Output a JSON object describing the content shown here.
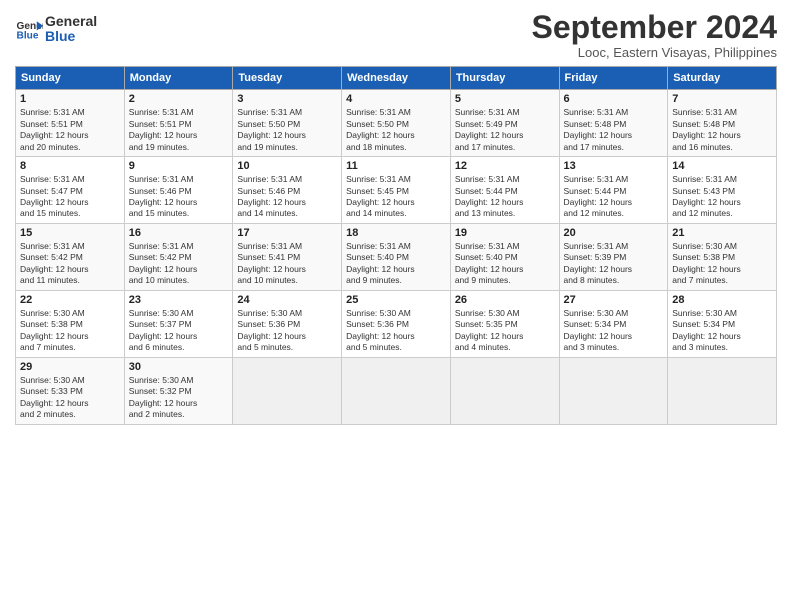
{
  "logo": {
    "line1": "General",
    "line2": "Blue"
  },
  "title": "September 2024",
  "subtitle": "Looc, Eastern Visayas, Philippines",
  "weekdays": [
    "Sunday",
    "Monday",
    "Tuesday",
    "Wednesday",
    "Thursday",
    "Friday",
    "Saturday"
  ],
  "weeks": [
    [
      {
        "day": "1",
        "info": "Sunrise: 5:31 AM\nSunset: 5:51 PM\nDaylight: 12 hours\nand 20 minutes."
      },
      {
        "day": "2",
        "info": "Sunrise: 5:31 AM\nSunset: 5:51 PM\nDaylight: 12 hours\nand 19 minutes."
      },
      {
        "day": "3",
        "info": "Sunrise: 5:31 AM\nSunset: 5:50 PM\nDaylight: 12 hours\nand 19 minutes."
      },
      {
        "day": "4",
        "info": "Sunrise: 5:31 AM\nSunset: 5:50 PM\nDaylight: 12 hours\nand 18 minutes."
      },
      {
        "day": "5",
        "info": "Sunrise: 5:31 AM\nSunset: 5:49 PM\nDaylight: 12 hours\nand 17 minutes."
      },
      {
        "day": "6",
        "info": "Sunrise: 5:31 AM\nSunset: 5:48 PM\nDaylight: 12 hours\nand 17 minutes."
      },
      {
        "day": "7",
        "info": "Sunrise: 5:31 AM\nSunset: 5:48 PM\nDaylight: 12 hours\nand 16 minutes."
      }
    ],
    [
      {
        "day": "8",
        "info": "Sunrise: 5:31 AM\nSunset: 5:47 PM\nDaylight: 12 hours\nand 15 minutes."
      },
      {
        "day": "9",
        "info": "Sunrise: 5:31 AM\nSunset: 5:46 PM\nDaylight: 12 hours\nand 15 minutes."
      },
      {
        "day": "10",
        "info": "Sunrise: 5:31 AM\nSunset: 5:46 PM\nDaylight: 12 hours\nand 14 minutes."
      },
      {
        "day": "11",
        "info": "Sunrise: 5:31 AM\nSunset: 5:45 PM\nDaylight: 12 hours\nand 14 minutes."
      },
      {
        "day": "12",
        "info": "Sunrise: 5:31 AM\nSunset: 5:44 PM\nDaylight: 12 hours\nand 13 minutes."
      },
      {
        "day": "13",
        "info": "Sunrise: 5:31 AM\nSunset: 5:44 PM\nDaylight: 12 hours\nand 12 minutes."
      },
      {
        "day": "14",
        "info": "Sunrise: 5:31 AM\nSunset: 5:43 PM\nDaylight: 12 hours\nand 12 minutes."
      }
    ],
    [
      {
        "day": "15",
        "info": "Sunrise: 5:31 AM\nSunset: 5:42 PM\nDaylight: 12 hours\nand 11 minutes."
      },
      {
        "day": "16",
        "info": "Sunrise: 5:31 AM\nSunset: 5:42 PM\nDaylight: 12 hours\nand 10 minutes."
      },
      {
        "day": "17",
        "info": "Sunrise: 5:31 AM\nSunset: 5:41 PM\nDaylight: 12 hours\nand 10 minutes."
      },
      {
        "day": "18",
        "info": "Sunrise: 5:31 AM\nSunset: 5:40 PM\nDaylight: 12 hours\nand 9 minutes."
      },
      {
        "day": "19",
        "info": "Sunrise: 5:31 AM\nSunset: 5:40 PM\nDaylight: 12 hours\nand 9 minutes."
      },
      {
        "day": "20",
        "info": "Sunrise: 5:31 AM\nSunset: 5:39 PM\nDaylight: 12 hours\nand 8 minutes."
      },
      {
        "day": "21",
        "info": "Sunrise: 5:30 AM\nSunset: 5:38 PM\nDaylight: 12 hours\nand 7 minutes."
      }
    ],
    [
      {
        "day": "22",
        "info": "Sunrise: 5:30 AM\nSunset: 5:38 PM\nDaylight: 12 hours\nand 7 minutes."
      },
      {
        "day": "23",
        "info": "Sunrise: 5:30 AM\nSunset: 5:37 PM\nDaylight: 12 hours\nand 6 minutes."
      },
      {
        "day": "24",
        "info": "Sunrise: 5:30 AM\nSunset: 5:36 PM\nDaylight: 12 hours\nand 5 minutes."
      },
      {
        "day": "25",
        "info": "Sunrise: 5:30 AM\nSunset: 5:36 PM\nDaylight: 12 hours\nand 5 minutes."
      },
      {
        "day": "26",
        "info": "Sunrise: 5:30 AM\nSunset: 5:35 PM\nDaylight: 12 hours\nand 4 minutes."
      },
      {
        "day": "27",
        "info": "Sunrise: 5:30 AM\nSunset: 5:34 PM\nDaylight: 12 hours\nand 3 minutes."
      },
      {
        "day": "28",
        "info": "Sunrise: 5:30 AM\nSunset: 5:34 PM\nDaylight: 12 hours\nand 3 minutes."
      }
    ],
    [
      {
        "day": "29",
        "info": "Sunrise: 5:30 AM\nSunset: 5:33 PM\nDaylight: 12 hours\nand 2 minutes."
      },
      {
        "day": "30",
        "info": "Sunrise: 5:30 AM\nSunset: 5:32 PM\nDaylight: 12 hours\nand 2 minutes."
      },
      null,
      null,
      null,
      null,
      null
    ]
  ]
}
